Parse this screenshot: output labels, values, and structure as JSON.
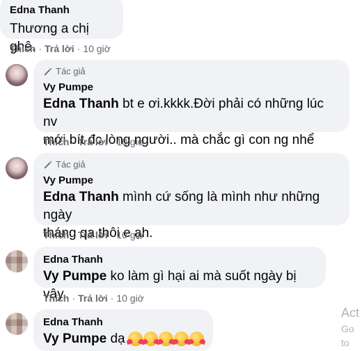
{
  "comments": [
    {
      "author": "Edna Thanh",
      "text": "Thương a chị ghê.",
      "actions": {
        "like": "Thích",
        "reply": "Trả lời",
        "time": "10 giờ"
      }
    },
    {
      "badge": "Tác giả",
      "author": "Vy Pumpe",
      "mention": "Edna Thanh",
      "text_line1": " bt e ơi.kkkk.Đời phải có những lúc nv",
      "text_line2": "mới bít đc lòng người.. mà chắc gì con ng nhể",
      "actions": {
        "like": "Thích",
        "reply": "Trả lời",
        "time": "10 giờ"
      }
    },
    {
      "badge": "Tác giả",
      "author": "Vy Pumpe",
      "mention": "Edna Thanh",
      "text_line1": " mình cứ sống là mình như những ngày",
      "text_line2": "tháng qa thôi e ạh.",
      "actions": {
        "like": "Thích",
        "reply": "Trả lời",
        "time": "10 giờ"
      }
    },
    {
      "author": "Edna Thanh",
      "mention": "Vy Pumpe",
      "text": " ko làm gì hại ai mà suốt ngày bị vậy.",
      "actions": {
        "like": "Thích",
        "reply": "Trả lời",
        "time": "10 giờ"
      }
    },
    {
      "author": "Edna Thanh",
      "mention": "Vy Pumpe",
      "text": " dạ",
      "emoji": "smiling-face-with-hearts",
      "emoji_count": 5
    }
  ],
  "watermark": {
    "line1": "Act",
    "line2": "Go to"
  },
  "separator": "·"
}
